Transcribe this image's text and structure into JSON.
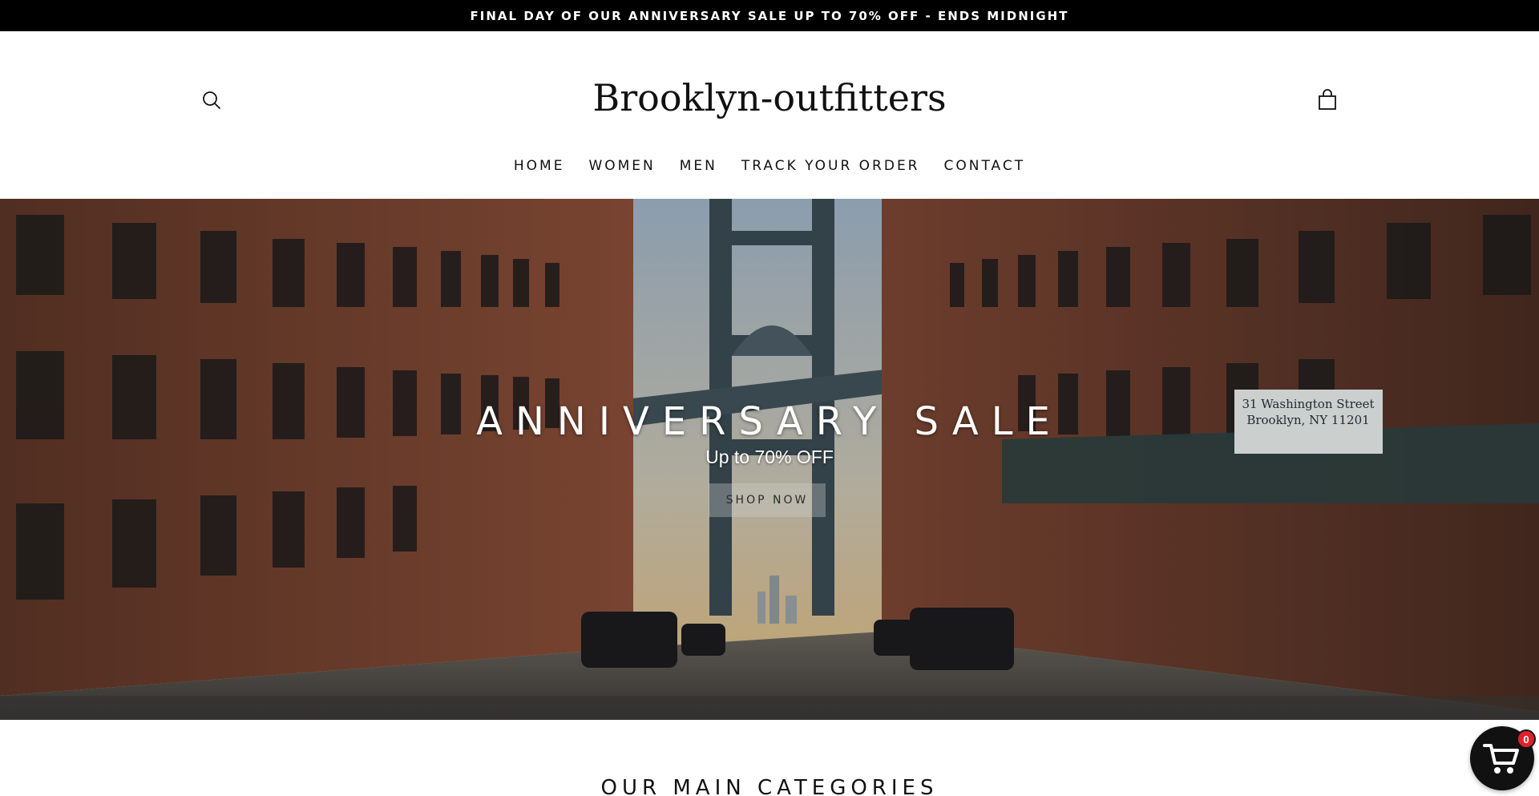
{
  "announcement": {
    "text": "FINAL DAY OF OUR ANNIVERSARY SALE UP TO 70% OFF - ENDS MIDNIGHT"
  },
  "header": {
    "logo": "Brooklyn-outfitters",
    "search_icon": "search-icon",
    "cart_icon": "shopping-bag-icon"
  },
  "nav": {
    "items": [
      {
        "label": "HOME"
      },
      {
        "label": "WOMEN"
      },
      {
        "label": "MEN"
      },
      {
        "label": "TRACK YOUR ORDER"
      },
      {
        "label": "CONTACT"
      }
    ]
  },
  "hero": {
    "title": "ANNIVERSARY SALE",
    "subtitle": "Up to 70% OFF",
    "button_label": "SHOP NOW",
    "sign_text": [
      "31 Washington Street",
      "Brooklyn, NY 11201"
    ]
  },
  "sections": {
    "categories_heading": "OUR MAIN CATEGORIES"
  },
  "floating_cart": {
    "icon": "cart-icon",
    "count": "0"
  },
  "colors": {
    "announcement_bg": "#000000",
    "announcement_text": "#ffffff",
    "text": "#111111",
    "badge": "#e0202a"
  }
}
